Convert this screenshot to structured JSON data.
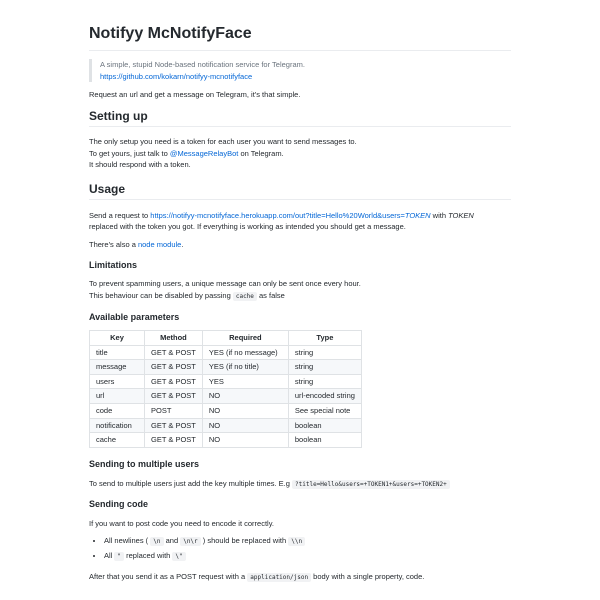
{
  "title": "Notifyy McNotifyFace",
  "quote": {
    "line1": "A simple, stupid Node-based notification service for Telegram.",
    "link": "https://github.com/kokarn/notifyy-mcnotifyface"
  },
  "intro": "Request an url and get a message on Telegram, it's that simple.",
  "setup": {
    "heading": "Setting up",
    "line1": "The only setup you need is a token for each user you want to send messages to.",
    "line2_pre": "To get yours, just talk to ",
    "line2_link": "@MessageRelayBot",
    "line2_post": " on Telegram.",
    "line3": "It should respond with a token."
  },
  "usage": {
    "heading": "Usage",
    "p1_pre": "Send a request to ",
    "p1_link": "https://notifyy-mcnotifyface.herokuapp.com/out?title=Hello%20World&users=",
    "p1_link_em": "TOKEN",
    "p1_mid": " with ",
    "p1_em": "TOKEN",
    "p1_line2": "replaced with the token you got. If everything is working as intended you should get a message.",
    "p2_pre": "There's also a ",
    "p2_link": "node module",
    "p2_post": "."
  },
  "limitations": {
    "heading": "Limitations",
    "line1": "To prevent spamming users, a unique message can only be sent once every hour.",
    "line2_pre": "This behaviour can be disabled by passing ",
    "line2_code": "cache",
    "line2_post": " as false"
  },
  "params": {
    "heading": "Available parameters",
    "headers": [
      "Key",
      "Method",
      "Required",
      "Type"
    ],
    "rows": [
      [
        "title",
        "GET & POST",
        "YES (if no message)",
        "string"
      ],
      [
        "message",
        "GET & POST",
        "YES (if no title)",
        "string"
      ],
      [
        "users",
        "GET & POST",
        "YES",
        "string"
      ],
      [
        "url",
        "GET & POST",
        "NO",
        "url-encoded string"
      ],
      [
        "code",
        "POST",
        "NO",
        "See special note"
      ],
      [
        "notification",
        "GET & POST",
        "NO",
        "boolean"
      ],
      [
        "cache",
        "GET & POST",
        "NO",
        "boolean"
      ]
    ]
  },
  "multiple": {
    "heading": "Sending to multiple users",
    "text": "To send to multiple users just add the key multiple times. E.g ",
    "code": "?title=Hello&users=+TOKEN1+&users=+TOKEN2+"
  },
  "sendcode": {
    "heading": "Sending code",
    "text": "If you want to post code you need to encode it correctly.",
    "b1_pre": "All newlines ( ",
    "b1_c1": "\\n",
    "b1_mid1": " and ",
    "b1_c2": "\\n\\r",
    "b1_mid2": " ) should be replaced with ",
    "b1_c3": "\\\\n",
    "b2_pre": "All ",
    "b2_c1": "\"",
    "b2_mid": " replaced with ",
    "b2_c2": "\\\"",
    "after_pre": "After that you send it as a POST request with a ",
    "after_code": "application/json",
    "after_post": " body with a single property, code."
  }
}
